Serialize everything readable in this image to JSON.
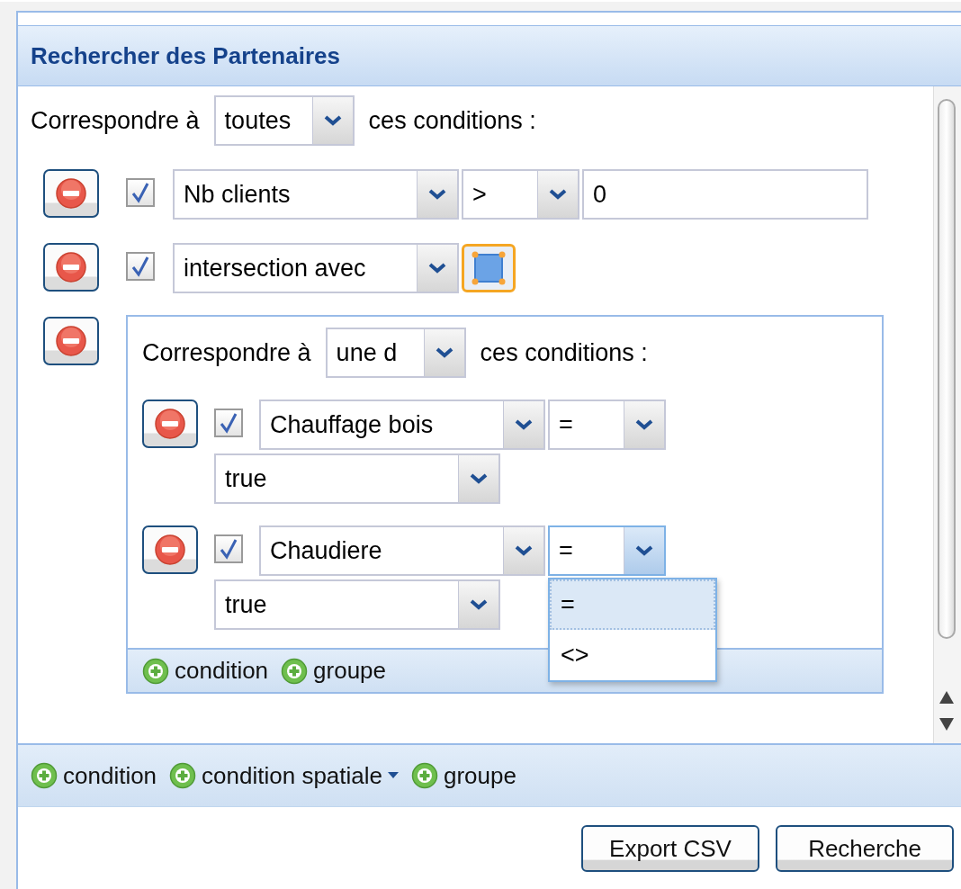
{
  "panel": {
    "title": "Rechercher des Partenaires"
  },
  "group": {
    "label_before": "Correspondre à",
    "match": "toutes",
    "label_after": "ces conditions :",
    "conditions": [
      {
        "kind": "attribute",
        "enabled": true,
        "field": "Nb clients",
        "operator": ">",
        "value": "0"
      },
      {
        "kind": "spatial",
        "enabled": true,
        "field": "intersection avec",
        "tool_selected": true
      },
      {
        "kind": "group",
        "label_before": "Correspondre à",
        "match": "une d",
        "label_after": "ces conditions :",
        "conditions": [
          {
            "kind": "choice",
            "enabled": true,
            "field": "Chauffage bois",
            "operator": "=",
            "operator_open": false,
            "value": "true"
          },
          {
            "kind": "choice",
            "enabled": true,
            "field": "Chaudiere",
            "operator": "=",
            "operator_open": true,
            "options": [
              {
                "label": "=",
                "selected": true
              },
              {
                "label": "<>",
                "selected": false
              }
            ],
            "value": "true"
          }
        ],
        "toolbar": [
          {
            "label": "condition"
          },
          {
            "label": "groupe"
          }
        ]
      }
    ]
  },
  "toolbar": [
    {
      "label": "condition",
      "menu": false
    },
    {
      "label": "condition spatiale",
      "menu": true
    },
    {
      "label": "groupe",
      "menu": false
    }
  ],
  "buttons": [
    "Export CSV",
    "Recherche"
  ]
}
